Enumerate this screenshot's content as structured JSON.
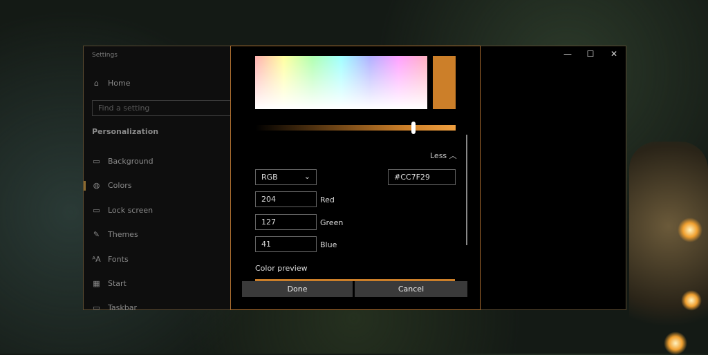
{
  "settings": {
    "title": "Settings",
    "home": "Home",
    "search_placeholder": "Find a setting",
    "section": "Personalization",
    "nav": [
      {
        "label": "Background",
        "icon": "image-icon"
      },
      {
        "label": "Colors",
        "icon": "palette-icon"
      },
      {
        "label": "Lock screen",
        "icon": "lock-screen-icon"
      },
      {
        "label": "Themes",
        "icon": "themes-icon"
      },
      {
        "label": "Fonts",
        "icon": "fonts-icon"
      },
      {
        "label": "Start",
        "icon": "start-icon"
      },
      {
        "label": "Taskbar",
        "icon": "taskbar-icon"
      }
    ],
    "controls": {
      "minimize": "—",
      "maximize": "☐",
      "close": "✕"
    }
  },
  "picker": {
    "color": "#CC7F29",
    "less_label": "Less",
    "mode": "RGB",
    "hex": "#CC7F29",
    "red": "204",
    "red_label": "Red",
    "green": "127",
    "green_label": "Green",
    "blue": "41",
    "blue_label": "Blue",
    "preview_label": "Color preview",
    "done": "Done",
    "cancel": "Cancel",
    "slider_value": 0.79
  }
}
